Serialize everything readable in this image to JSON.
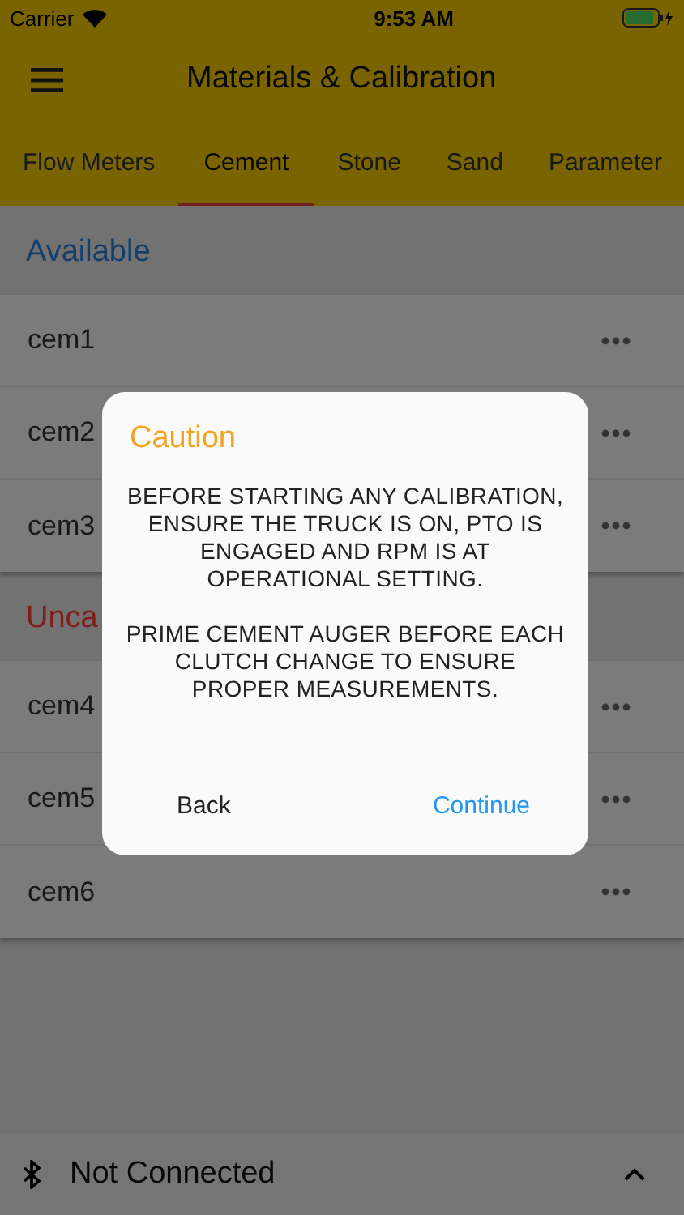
{
  "status_bar": {
    "carrier": "Carrier",
    "time": "9:53 AM"
  },
  "app_bar": {
    "title": "Materials & Calibration"
  },
  "tabs": [
    {
      "label": "Flow Meters",
      "selected": false
    },
    {
      "label": "Cement",
      "selected": true
    },
    {
      "label": "Stone",
      "selected": false
    },
    {
      "label": "Sand",
      "selected": false
    },
    {
      "label": "Parameter",
      "selected": false
    }
  ],
  "sections": [
    {
      "title": "Available",
      "kind": "available",
      "items": [
        "cem1",
        "cem2",
        "cem3"
      ]
    },
    {
      "title": "Unca",
      "kind": "uncalibrated",
      "items": [
        "cem4",
        "cem5",
        "cem6"
      ]
    }
  ],
  "dialog": {
    "title": "Caution",
    "paragraphs": [
      "BEFORE STARTING ANY CALIBRATION, ENSURE THE TRUCK IS ON, PTO IS ENGAGED AND RPM IS AT OPERATIONAL SETTING.",
      "PRIME CEMENT AUGER BEFORE EACH CLUTCH CHANGE TO ENSURE PROPER MEASUREMENTS."
    ],
    "buttons": [
      {
        "label": "Back",
        "kind": "cancel"
      },
      {
        "label": "Continue",
        "kind": "confirm"
      }
    ]
  },
  "connection_bar": {
    "status": "Not Connected"
  }
}
